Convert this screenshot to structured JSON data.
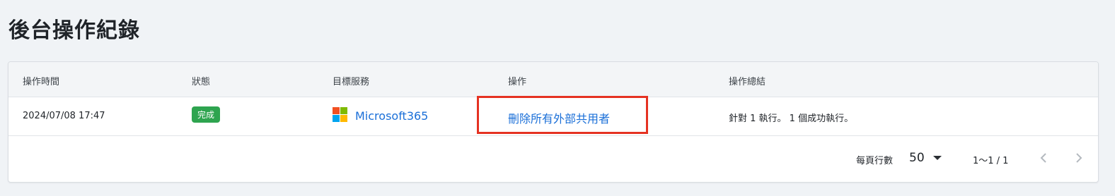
{
  "page": {
    "title": "後台操作紀錄"
  },
  "table": {
    "headers": [
      "操作時間",
      "狀態",
      "目標服務",
      "操作",
      "操作總結"
    ],
    "rows": [
      {
        "time": "2024/07/08 17:47",
        "status": "完成",
        "service": "Microsoft365",
        "action": "刪除所有外部共用者",
        "summary": "針對 1 執行。 1 個成功執行。"
      }
    ]
  },
  "pagination": {
    "rows_per_page_label": "每頁行數",
    "rows_per_page": "50",
    "range": "1〜1 / 1"
  },
  "icons": {
    "service": "microsoft-logo-icon",
    "dropdown": "caret-down-icon",
    "prev": "chevron-left-icon",
    "next": "chevron-right-icon"
  },
  "colors": {
    "status_complete": "#2ea44f",
    "link": "#1a6fd8",
    "highlight": "#e53222",
    "ms_red": "#f25022",
    "ms_green": "#7fba00",
    "ms_blue": "#00a4ef",
    "ms_yellow": "#ffb900"
  }
}
